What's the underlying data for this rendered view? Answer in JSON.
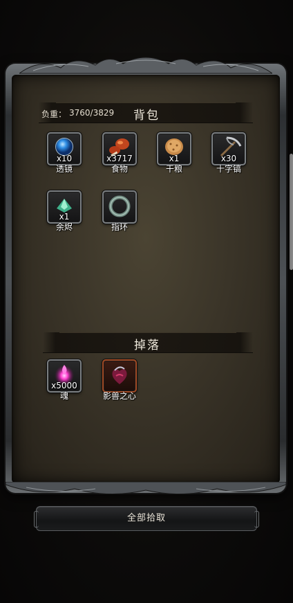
{
  "bag": {
    "title": "背包",
    "weight_label": "负重：",
    "weight_value": "3760/3829",
    "items": [
      {
        "name": "透镜",
        "qty": "x10",
        "icon": "lens-orb-icon"
      },
      {
        "name": "食物",
        "qty": "x3717",
        "icon": "roast-meat-icon"
      },
      {
        "name": "干粮",
        "qty": "x1",
        "icon": "biscuit-icon"
      },
      {
        "name": "十字镐",
        "qty": "x30",
        "icon": "pickaxe-icon"
      },
      {
        "name": "余烬",
        "qty": "x1",
        "icon": "ember-icon"
      },
      {
        "name": "指环",
        "qty": "",
        "icon": "ring-icon"
      }
    ]
  },
  "drops": {
    "title": "掉落",
    "items": [
      {
        "name": "魂",
        "qty": "x5000",
        "icon": "soul-icon"
      },
      {
        "name": "影兽之心",
        "qty": "",
        "icon": "beast-heart-icon"
      }
    ]
  },
  "actions": {
    "pickup_all": "全部拾取"
  }
}
